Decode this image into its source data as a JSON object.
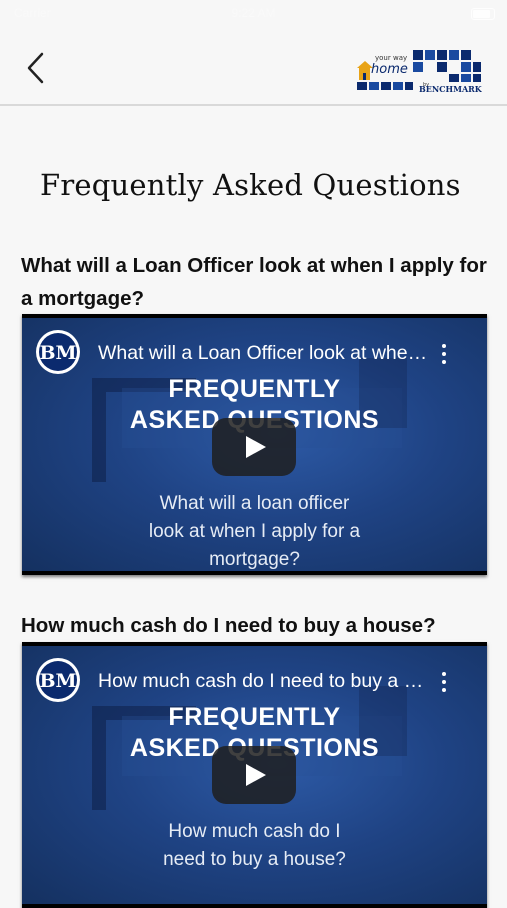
{
  "status_bar": {
    "carrier": "Carrier",
    "time": "9:22 AM"
  },
  "header": {
    "back_label": "Back",
    "logo": {
      "line1": "your way",
      "line2": "home",
      "by": "by",
      "brand": "BENCHMARK"
    }
  },
  "page": {
    "title": "Frequently Asked Questions"
  },
  "faqs": [
    {
      "question": "What will a Loan Officer look at when I apply for a mortgage?",
      "video": {
        "channel_initials": "BM",
        "title": "What will a Loan Officer look at when I apply for a mortgage?",
        "overlay_heading_line1": "FREQUENTLY",
        "overlay_heading_line2": "ASKED QUESTIONS",
        "caption": "What will a loan officer look at when I apply for a mortgage?"
      }
    },
    {
      "question": "How much cash do I need to buy a house?",
      "video": {
        "channel_initials": "BM",
        "title": "How much cash do I need to buy a house?",
        "overlay_heading_line1": "FREQUENTLY",
        "overlay_heading_line2": "ASKED QUESTIONS",
        "caption": "How much cash do I need to buy a house?"
      }
    }
  ],
  "colors": {
    "video_bg": "#1f4384",
    "logo_blue": "#0b2a6e",
    "logo_gold": "#e8a317",
    "play_button": "#1f1f1f"
  }
}
